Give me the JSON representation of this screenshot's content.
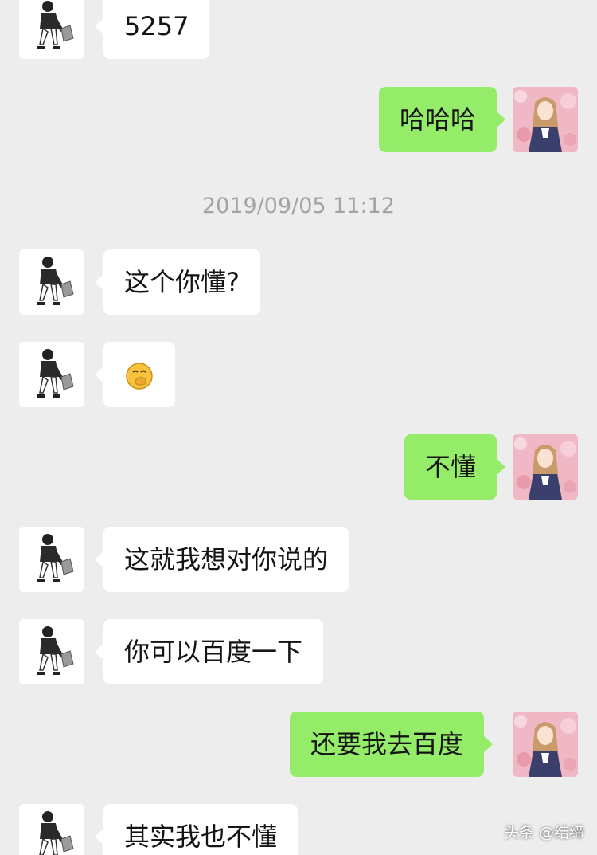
{
  "timestamp": "2019/09/05 11:12",
  "watermark": "头条 @结缔",
  "colors": {
    "background": "#ededed",
    "incoming_bubble": "#ffffff",
    "outgoing_bubble": "#95ec69",
    "timestamp_text": "#a3a3a3"
  },
  "messages": [
    {
      "side": "left",
      "text": "5257"
    },
    {
      "side": "right",
      "text": "哈哈哈"
    },
    {
      "side": "left",
      "text": "这个你懂?"
    },
    {
      "side": "left",
      "text": "",
      "emoji": "smirk-hand-over-mouth-emoji"
    },
    {
      "side": "right",
      "text": "不懂"
    },
    {
      "side": "left",
      "text": "这就我想对你说的"
    },
    {
      "side": "left",
      "text": "你可以百度一下"
    },
    {
      "side": "right",
      "text": "还要我去百度"
    },
    {
      "side": "left",
      "text": "其实我也不懂"
    }
  ]
}
